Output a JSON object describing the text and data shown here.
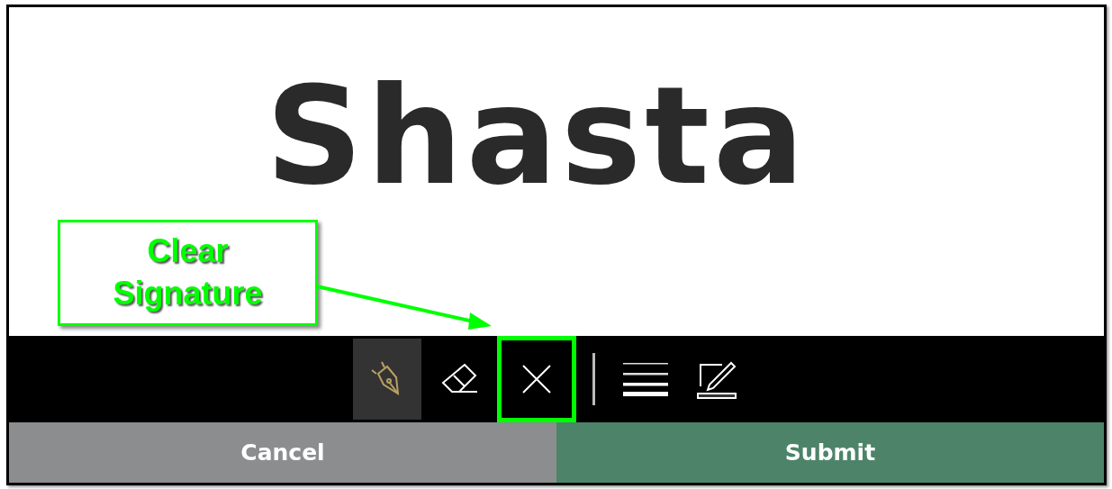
{
  "signature_pad": {
    "signature": "Shasta"
  },
  "toolbar": [
    {
      "kind": "pen",
      "selected": true,
      "highlighted": false
    },
    {
      "kind": "eraser",
      "selected": false,
      "highlighted": false
    },
    {
      "kind": "clear",
      "selected": false,
      "highlighted": true
    },
    {
      "kind": "divider"
    },
    {
      "kind": "stroke-width",
      "selected": false,
      "highlighted": false
    },
    {
      "kind": "edit",
      "selected": false,
      "highlighted": false
    }
  ],
  "buttons": [
    {
      "kind": "cancel",
      "label": "Cancel"
    },
    {
      "kind": "submit",
      "label": "Submit"
    }
  ],
  "callout": {
    "text": "Clear Signature"
  }
}
